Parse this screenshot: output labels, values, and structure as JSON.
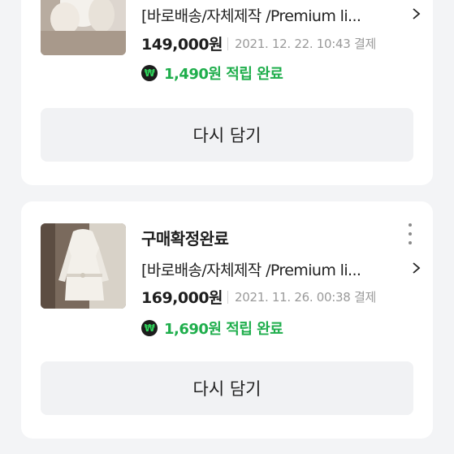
{
  "orders": [
    {
      "status": "",
      "title": "[바로배송/자체제작 /Premium li...",
      "price": "149,000원",
      "date": "2021. 12. 22. 10:43 결제",
      "points": "1,490원 적립 완료",
      "reorder_label": "다시 담기"
    },
    {
      "status": "구매확정완료",
      "title": "[바로배송/자체제작 /Premium li...",
      "price": "169,000원",
      "date": "2021. 11. 26. 00:38 결제",
      "points": "1,690원 적립 완료",
      "reorder_label": "다시 담기"
    }
  ],
  "icons": {
    "points_icon": "₩",
    "chevron": "chevron-right-icon",
    "more": "more-vertical-icon"
  },
  "colors": {
    "background": "#f3f4f6",
    "card": "#ffffff",
    "points_green": "#1fae4c",
    "button_bg": "#f1f2f4"
  }
}
